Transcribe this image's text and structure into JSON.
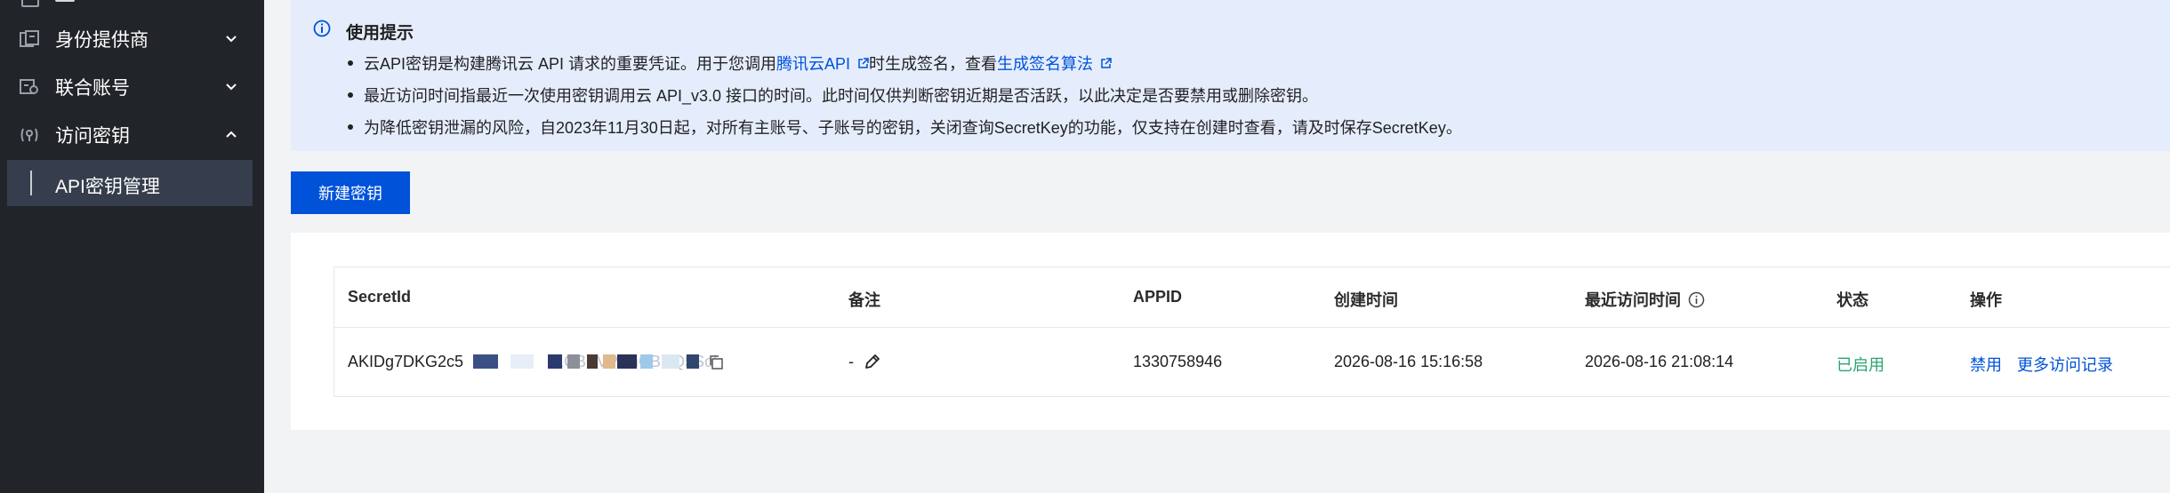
{
  "sidebar": {
    "items": [
      {
        "label": "身份提供商",
        "icon": "identity-provider-icon",
        "expanded": false
      },
      {
        "label": "联合账号",
        "icon": "federated-account-icon",
        "expanded": false
      },
      {
        "label": "访问密钥",
        "icon": "access-key-icon",
        "expanded": true
      }
    ],
    "active_subitem": "API密钥管理"
  },
  "notice": {
    "title": "使用提示",
    "line1": {
      "pre": "云API密钥是构建腾讯云 API 请求的重要凭证。用于您调用",
      "link1": "腾讯云API",
      "mid": "时生成签名，查看",
      "link2": "生成签名算法"
    },
    "line2": "最近访问时间指最近一次使用密钥调用云 API_v3.0 接口的时间。此时间仅供判断密钥近期是否活跃，以此决定是否要禁用或删除密钥。",
    "line3": "为降低密钥泄漏的风险，自2023年11月30日起，对所有主账号、子账号的密钥，关闭查询SecretKey的功能，仅支持在创建时查看，请及时保存SecretKey。"
  },
  "create_button": "新建密钥",
  "table": {
    "columns": [
      "SecretId",
      "备注",
      "APPID",
      "创建时间",
      "最近访问时间",
      "状态",
      "操作"
    ],
    "rows": [
      {
        "secret_id": "AKIDg7DKG2c5",
        "secret_id_masked_tail": "1CBYVPCnCBUQ5Sok",
        "remark": "-",
        "appid": "1330758946",
        "created": "2026-08-16 15:16:58",
        "last_access": "2026-08-16 21:08:14",
        "status": "已启用",
        "actions": [
          "禁用",
          "更多访问记录"
        ]
      }
    ]
  },
  "colors": {
    "sidebar_bg": "#212529",
    "sidebar_active": "#363d4c",
    "notice_bg": "#e5edfd",
    "primary": "#0052d9",
    "success": "#2ba471"
  }
}
